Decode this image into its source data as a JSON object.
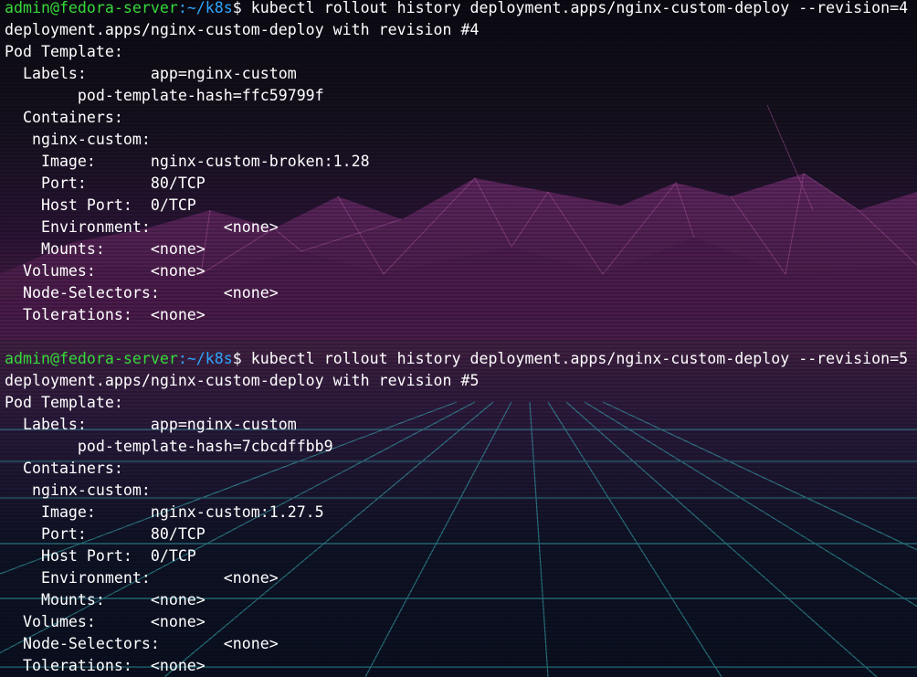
{
  "prompt": {
    "user_host": "admin@fedora-server",
    "path": ":~/k8s",
    "symbol": "$"
  },
  "blocks": [
    {
      "command": "kubectl rollout history deployment.apps/nginx-custom-deploy --revision=4",
      "output": [
        "deployment.apps/nginx-custom-deploy with revision #4",
        "Pod Template:",
        "  Labels:       app=nginx-custom",
        "        pod-template-hash=ffc59799f",
        "  Containers:",
        "   nginx-custom:",
        "    Image:      nginx-custom-broken:1.28",
        "    Port:       80/TCP",
        "    Host Port:  0/TCP",
        "    Environment:        <none>",
        "    Mounts:     <none>",
        "  Volumes:      <none>",
        "  Node-Selectors:       <none>",
        "  Tolerations:  <none>",
        ""
      ]
    },
    {
      "command": "kubectl rollout history deployment.apps/nginx-custom-deploy --revision=5",
      "output": [
        "deployment.apps/nginx-custom-deploy with revision #5",
        "Pod Template:",
        "  Labels:       app=nginx-custom",
        "        pod-template-hash=7cbcdffbb9",
        "  Containers:",
        "   nginx-custom:",
        "    Image:      nginx-custom:1.27.5",
        "    Port:       80/TCP",
        "    Host Port:  0/TCP",
        "    Environment:        <none>",
        "    Mounts:     <none>",
        "  Volumes:      <none>",
        "  Node-Selectors:       <none>",
        "  Tolerations:  <none>"
      ]
    }
  ],
  "colors": {
    "user_host": "#36d93b",
    "path": "#2fa6ff",
    "text": "#ffffff"
  }
}
